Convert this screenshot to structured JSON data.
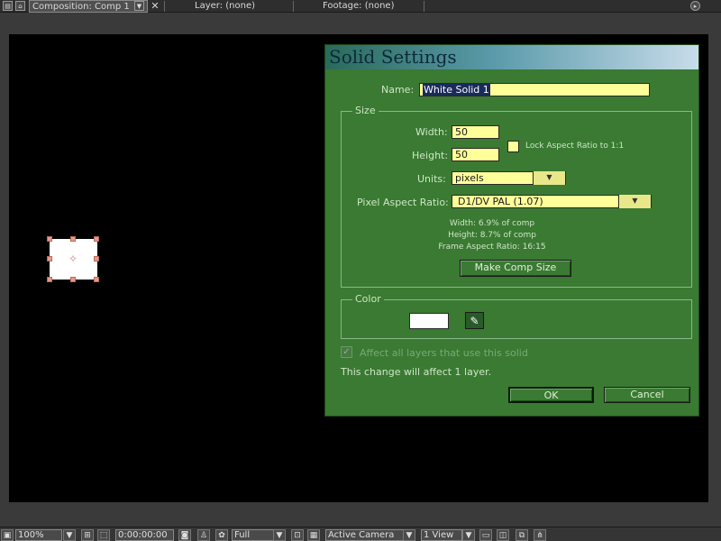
{
  "tabs": {
    "composition": "Composition: Comp 1",
    "layer": "Layer: (none)",
    "footage": "Footage: (none)"
  },
  "dialog": {
    "title": "Solid Settings",
    "name_label": "Name:",
    "name_value": "White Solid 1",
    "size_group": "Size",
    "width_label": "Width:",
    "width_value": "50",
    "height_label": "Height:",
    "height_value": "50",
    "lock_aspect_label": "Lock Aspect Ratio to 1:1",
    "units_label": "Units:",
    "units_value": "pixels",
    "par_label": "Pixel Aspect Ratio:",
    "par_value": "D1/DV PAL (1.07)",
    "info_width": "Width:    6.9% of comp",
    "info_height": "Height:    8.7% of comp",
    "info_frame": "Frame Aspect Ratio: 16:15",
    "make_comp_size": "Make Comp Size",
    "color_group": "Color",
    "color_swatch": "#ffffff",
    "affect_all_label": "Affect all layers that use this solid",
    "change_note": "This change will affect 1 layer.",
    "ok": "OK",
    "cancel": "Cancel"
  },
  "bottom_bar": {
    "zoom": "100%",
    "timecode": "0:00:00:00",
    "resolution": "Full",
    "camera": "Active Camera",
    "views": "1 View"
  },
  "colors": {
    "dialog_bg": "#3a7a32",
    "field_bg": "#ffff9a",
    "viewer_bg": "#000000"
  }
}
